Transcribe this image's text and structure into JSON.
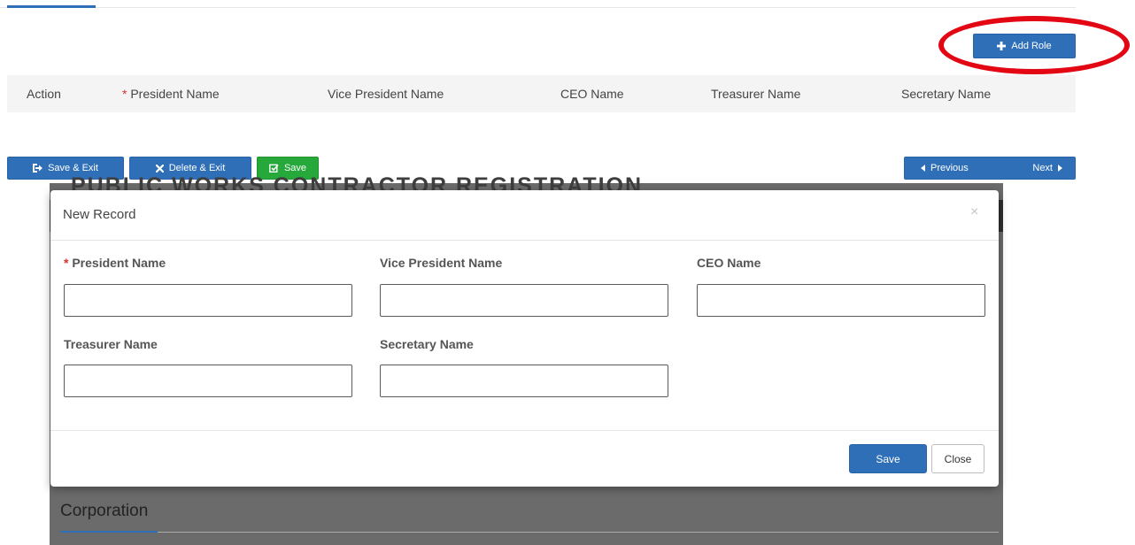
{
  "toolbar": {
    "add_role_label": "Add Role",
    "save_exit_label": "Save & Exit",
    "delete_exit_label": "Delete & Exit",
    "save_label": "Save",
    "previous_label": "Previous",
    "next_label": "Next"
  },
  "grid": {
    "columns": [
      {
        "label": "Action",
        "required": false
      },
      {
        "label": "President Name",
        "required": true
      },
      {
        "label": "Vice President Name",
        "required": false
      },
      {
        "label": "CEO Name",
        "required": false
      },
      {
        "label": "Treasurer Name",
        "required": false
      },
      {
        "label": "Secretary Name",
        "required": false
      }
    ],
    "required_marker": "*"
  },
  "background": {
    "title": "PUBLIC WORKS CONTRACTOR REGISTRATION",
    "section_title": "Corporation"
  },
  "modal": {
    "title": "New Record",
    "close_symbol": "×",
    "fields": {
      "president": {
        "label": "President Name",
        "value": "",
        "required": true
      },
      "vice_president": {
        "label": "Vice President Name",
        "value": ""
      },
      "ceo": {
        "label": "CEO Name",
        "value": ""
      },
      "treasurer": {
        "label": "Treasurer Name",
        "value": ""
      },
      "secretary": {
        "label": "Secretary Name",
        "value": ""
      }
    },
    "save_label": "Save",
    "close_label": "Close"
  },
  "icons": {
    "add": "plus-icon",
    "save_exit": "sign-out-icon",
    "delete_exit": "times-icon",
    "save": "check-square-icon",
    "previous": "caret-left-icon",
    "next": "caret-right-icon"
  },
  "colors": {
    "primary": "#2f6fb8",
    "success": "#27a83a",
    "required": "#d9302c",
    "highlight": "#e30613"
  }
}
